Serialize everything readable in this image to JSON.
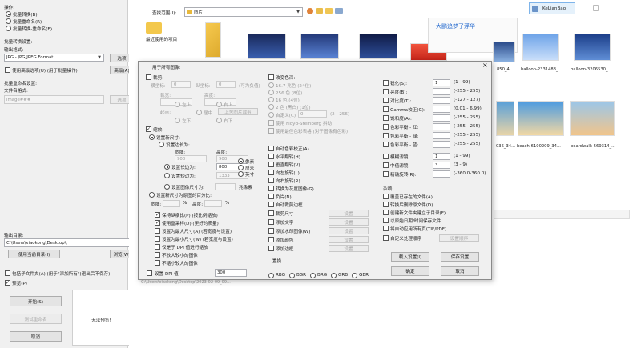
{
  "left": {
    "ops_label": "操作:",
    "ops": [
      "批量转换(B)",
      "批量重命名(R)",
      "批量转换-重命名(E)"
    ],
    "batch_settings": "批量转换设置:",
    "out_format_label": "输出格式:",
    "format_value": "JPG - JPG/JPEG Format",
    "options_btn": "选项",
    "use_advanced": "使用高级选项(U)   (用于批量操作)",
    "advanced_btn": "高级(A)",
    "rename_settings": "批量重命名设置:",
    "filename_pattern_label": "文件名格式:",
    "filename_pattern": "image###",
    "opts_btn": "选项",
    "out_dir_label": "输出目录:",
    "out_dir": "C:\\Users\\xiaokong\\Desktop\\",
    "use_current_btn": "使用当前目录(I)",
    "browse_btn": "浏览(W)",
    "include_subfolders": "包括子文件夹(A)   (用于\"添加所有\")退出后不保存)",
    "preview": "预览(P)",
    "start_btn": "开始(S)",
    "test_btn": "测试重命名",
    "cancel_btn": "取消",
    "no_preview": "无法预览!"
  },
  "browser": {
    "search_label": "查找范围(I):",
    "folder": "图片",
    "recent": "最近使用的项目",
    "user_badge": "KeLianBao",
    "ppt_title": "大鹏追梦了浮华",
    "captions": [
      "850_4...",
      "balloon-2331488_...",
      "balloon-3206530_...",
      "036_34...",
      "beach-6100209_34...",
      "boardwalk-569314_..."
    ],
    "fragments": [
      "C:",
      "C:",
      "C:",
      "C:"
    ],
    "bottom_cmd": "C:\\Users\\xiaokong\\Desktop\\2023-02-09_09..."
  },
  "dialog": {
    "title": "用于所有图像:",
    "close": "×",
    "crop": "裁剪:",
    "crop_width": "裁宽:",
    "crop_height": "高度:",
    "crop_fields": [
      "横坐标:",
      "纵坐标:",
      "(可为负值)"
    ],
    "crop_zero": "0",
    "crop_origin": "起点:",
    "crop_positions": [
      "左上",
      "右上",
      "居中",
      "左下",
      "右下"
    ],
    "crop_auto": "上舍图片裁剪",
    "resize": "缩放:",
    "set_new_size": "设置新尺寸:",
    "set_both": "设置边长为:",
    "width_lbl": "宽度:",
    "height_lbl": "高度:",
    "w_val": "900",
    "h_val": "900",
    "set_long": "设置长边为:",
    "long_val": "800",
    "set_short": "设置短边为:",
    "short_val": "1333",
    "units": [
      "像素",
      "厘米",
      "英寸"
    ],
    "set_size": "设置图像尺寸为:",
    "megapixel": "兆像素",
    "percent": "设置新尺寸为原图的百分比:",
    "pct_w": "宽度:",
    "pct_w_unit": "%",
    "pct_h": "高度:",
    "pct_h_unit": "%",
    "keep_ratio": "保持纵横比(P) (按比例缩放)",
    "resample": "使用重采样(D) (更好的质量)",
    "width_max": "设置为最大尺寸(A) (若宽度与设置)",
    "height_max": "设置为最小尺寸(W) (若宽度与设置)",
    "only_dpi": "仅是于 DPI 值进行缩放",
    "no_enlarge": "不放大较小的图像",
    "no_shrink": "不缩小较大的图像",
    "dpi_label": "设置 DPI 值:",
    "dpi_val": "300",
    "change_color": "改变色深:",
    "colors": [
      "16.7 兆色 (24位)",
      "256 色 (8位)",
      "16 色 (4位)",
      "2 色 (黑白) (1位)",
      "自定义(C)"
    ],
    "custom_val": "0",
    "custom_range": "(2 - 256)",
    "floyd": "使用 Floyd-Steinberg 抖动",
    "custom_palette": "使用最佳色彩表格 (对于图像有色彩)",
    "left_ops": [
      "自动色彩校正(A)",
      "水平翻转(H)",
      "垂直翻转(V)",
      "向左旋转(L)",
      "向右旋转(R)",
      "转换为灰度图像(G)",
      "负片(N)",
      "自动裁剪边框",
      "裁剪尺寸",
      "添加文字",
      "添加水印图像(W)",
      "添加颜色",
      "添加边框"
    ],
    "set_label": "设置",
    "swap": "置换",
    "swap_opts": [
      "RBG",
      "BGR",
      "BRG",
      "GRB",
      "GBR"
    ],
    "adj": [
      {
        "label": "锐化(S):",
        "val": "1",
        "range": "(1 - 99)"
      },
      {
        "label": "亮度(B):",
        "val": "",
        "range": "(-255 - 255)"
      },
      {
        "label": "对比度(T):",
        "val": "",
        "range": "(-127 - 127)"
      },
      {
        "label": "Gamma校正(G):",
        "val": "",
        "range": "(0.01 - 6.99)"
      },
      {
        "label": "饱和度(A):",
        "val": "",
        "range": "(-255 - 255)"
      },
      {
        "label": "色彩平衡 - 红:",
        "val": "",
        "range": "(-255 - 255)"
      },
      {
        "label": "色彩平衡 - 绿:",
        "val": "",
        "range": "(-255 - 255)"
      },
      {
        "label": "色彩平衡 - 蓝:",
        "val": "",
        "range": "(-255 - 255)"
      },
      {
        "label": "模糊滤镜:",
        "val": "1",
        "range": "(1 - 99)"
      },
      {
        "label": "中值滤镜:",
        "val": "3",
        "range": "(3 - 9)"
      },
      {
        "label": "精确旋转(R):",
        "val": "",
        "range": "(-360.0-360.0)"
      }
    ],
    "misc_label": "杂项:",
    "misc": [
      "覆盖已存在的文件(A)",
      "转换后删除原文件(D)",
      "创建新文件夹建立子目录(F)",
      "以原始日期/时间保存文件",
      "将自动应用所有页(TIF/PDF)",
      "自定义处理顺序"
    ],
    "set_order": "设置顺序",
    "load_btn": "载入设置(I)",
    "save_btn": "保存设置",
    "ok_btn": "确定",
    "cancel_btn": "取消"
  }
}
